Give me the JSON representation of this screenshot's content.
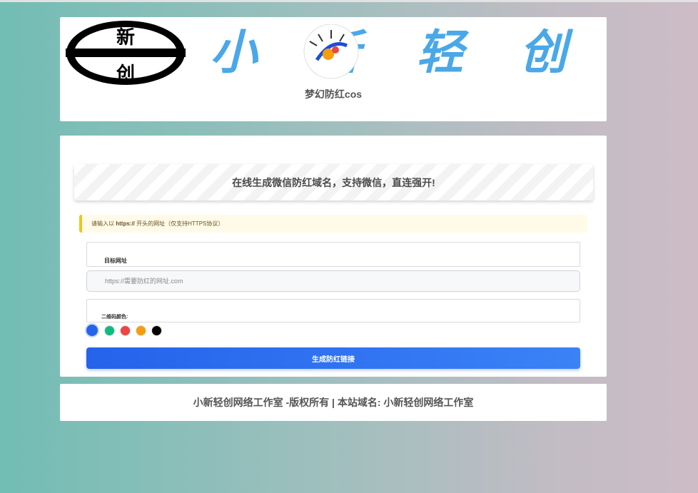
{
  "header": {
    "logo_seal_text": "新创",
    "logo_wordmark_text": "小新轻创",
    "subtitle": "梦幻防红cos"
  },
  "form": {
    "banner_text": "在线生成微信防红域名，支持微信，直连强开!",
    "notice_prefix": "请输入以",
    "notice_protocol": "https://",
    "notice_suffix": "开头的网址（仅支持HTTPS协议）",
    "url_label": "目标网址",
    "url_placeholder": "https://需要防红的网址.com",
    "url_value": "",
    "color_label": "二维码颜色:",
    "colors": [
      {
        "name": "blue",
        "hex": "#2563eb",
        "selected": true
      },
      {
        "name": "green",
        "hex": "#10b981",
        "selected": false
      },
      {
        "name": "red",
        "hex": "#ef4444",
        "selected": false
      },
      {
        "name": "orange",
        "hex": "#f59e0b",
        "selected": false
      },
      {
        "name": "black",
        "hex": "#000000",
        "selected": false
      }
    ],
    "submit_label": "生成防红链接"
  },
  "footer": {
    "text": "小新轻创网络工作室 -版权所有 | 本站域名: 小新轻创网络工作室"
  }
}
